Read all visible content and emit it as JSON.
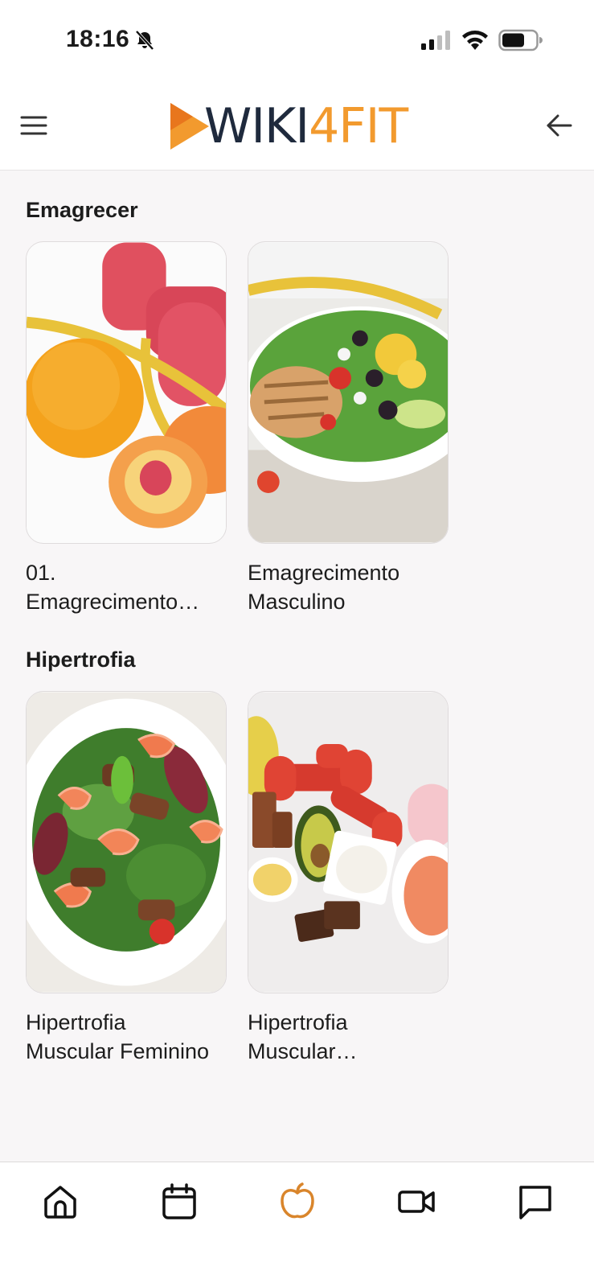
{
  "status_bar": {
    "time": "18:16",
    "icons": [
      "bell-off-icon",
      "signal-icon",
      "wifi-icon",
      "battery-icon"
    ]
  },
  "header": {
    "logo_wiki": "WIKI",
    "logo_four": "4",
    "logo_fit": "FIT",
    "menu_icon": "hamburger-menu-icon",
    "back_icon": "arrow-left-icon"
  },
  "sections": [
    {
      "title": "Emagrecer",
      "cards": [
        {
          "title_line1": "01.",
          "title_line2": "Emagrecimento…"
        },
        {
          "title_line1": "Emagrecimento",
          "title_line2": "Masculino"
        }
      ]
    },
    {
      "title": "Hipertrofia",
      "cards": [
        {
          "title_line1": "Hipertrofia",
          "title_line2": "Muscular Feminino"
        },
        {
          "title_line1": "Hipertrofia",
          "title_line2": "Muscular…"
        }
      ]
    }
  ],
  "bottom_nav": {
    "items": [
      "home-icon",
      "calendar-icon",
      "apple-icon",
      "video-icon",
      "chat-icon"
    ],
    "active": "apple-icon"
  },
  "colors": {
    "accent": "#d9852b",
    "logo_dark": "#1f2a3d",
    "logo_orange": "#f29a2e",
    "background": "#f8f6f7"
  }
}
